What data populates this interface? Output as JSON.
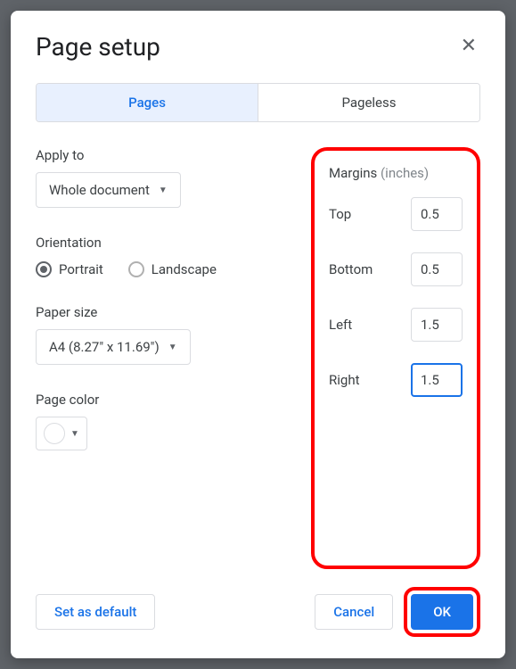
{
  "dialog": {
    "title": "Page setup"
  },
  "tabs": {
    "pages": "Pages",
    "pageless": "Pageless"
  },
  "applyTo": {
    "label": "Apply to",
    "value": "Whole document"
  },
  "orientation": {
    "label": "Orientation",
    "portrait": "Portrait",
    "landscape": "Landscape"
  },
  "paperSize": {
    "label": "Paper size",
    "value": "A4 (8.27\" x 11.69\")"
  },
  "pageColor": {
    "label": "Page color"
  },
  "margins": {
    "label": "Margins",
    "unit": "(inches)",
    "top": {
      "label": "Top",
      "value": "0.5"
    },
    "bottom": {
      "label": "Bottom",
      "value": "0.5"
    },
    "left": {
      "label": "Left",
      "value": "1.5"
    },
    "right": {
      "label": "Right",
      "value": "1.5"
    }
  },
  "footer": {
    "setDefault": "Set as default",
    "cancel": "Cancel",
    "ok": "OK"
  }
}
